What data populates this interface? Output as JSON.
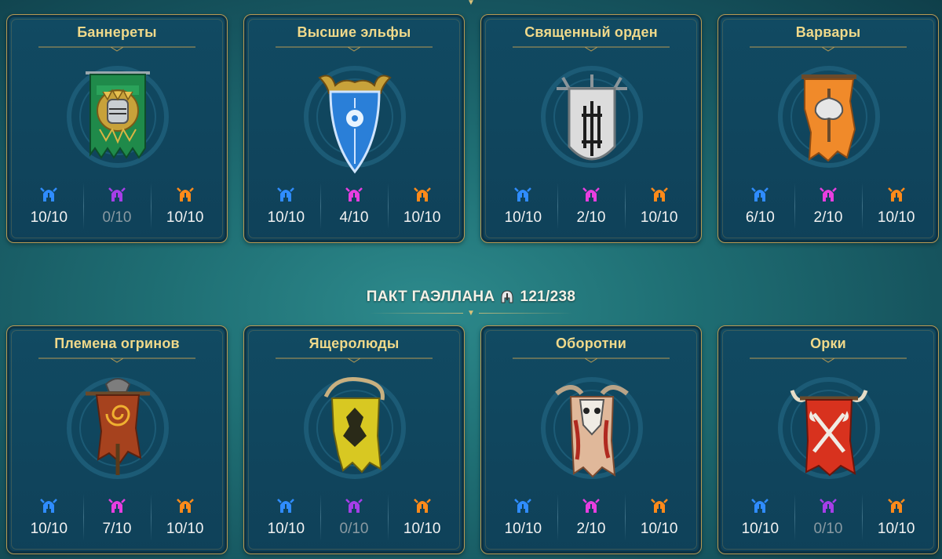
{
  "alliance": {
    "name": "ПАКТ ГАЭЛЛАНА",
    "value": "121/238"
  },
  "colors": {
    "blue": "#2f8cff",
    "purple": "#a63ee8",
    "orange": "#ff8a1a",
    "gold": "#f0d98a"
  },
  "cards": [
    {
      "title": "Баннереты",
      "stats": [
        "10/10",
        "0/10",
        "10/10"
      ],
      "emblem": "banner-knight-icon"
    },
    {
      "title": "Высшие эльфы",
      "stats": [
        "10/10",
        "4/10",
        "10/10"
      ],
      "emblem": "elf-shield-icon"
    },
    {
      "title": "Священный орден",
      "stats": [
        "10/10",
        "2/10",
        "10/10"
      ],
      "emblem": "sacred-order-shield-icon"
    },
    {
      "title": "Варвары",
      "stats": [
        "6/10",
        "2/10",
        "10/10"
      ],
      "emblem": "barbarian-axe-banner-icon"
    },
    {
      "title": "Племена огринов",
      "stats": [
        "10/10",
        "7/10",
        "10/10"
      ],
      "emblem": "ogryn-spiral-banner-icon"
    },
    {
      "title": "Ящеролюды",
      "stats": [
        "10/10",
        "0/10",
        "10/10"
      ],
      "emblem": "lizardmen-banner-icon"
    },
    {
      "title": "Оборотни",
      "stats": [
        "10/10",
        "2/10",
        "10/10"
      ],
      "emblem": "skinwalker-skull-banner-icon"
    },
    {
      "title": "Орки",
      "stats": [
        "10/10",
        "0/10",
        "10/10"
      ],
      "emblem": "orc-axes-banner-icon"
    }
  ]
}
